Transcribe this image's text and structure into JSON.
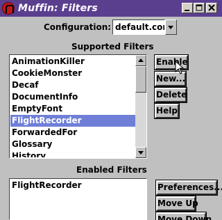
{
  "window": {
    "title": "Muffin: Filters",
    "controls": [
      "minimize",
      "maximize",
      "close"
    ]
  },
  "configuration": {
    "label": "Configuration:",
    "selected": "default.conf"
  },
  "supported": {
    "heading": "Supported Filters",
    "items": [
      "AnimationKiller",
      "CookieMonster",
      "Decaf",
      "DocumentInfo",
      "EmptyFont",
      "FlightRecorder",
      "ForwardedFor",
      "Glossary",
      "History"
    ],
    "selected_index": 5,
    "buttons": {
      "enable": "Enable",
      "new": "New...",
      "delete": "Delete",
      "help": "Help"
    }
  },
  "enabled": {
    "heading": "Enabled Filters",
    "items": [
      "FlightRecorder"
    ],
    "buttons": {
      "preferences": "Preferences...",
      "move_up": "Move Up",
      "move_down": "Move Down"
    }
  },
  "colors": {
    "titlebar": "#5b3f8f",
    "selection": "#6f7fd8",
    "window_bg": "#c0c0c0"
  }
}
